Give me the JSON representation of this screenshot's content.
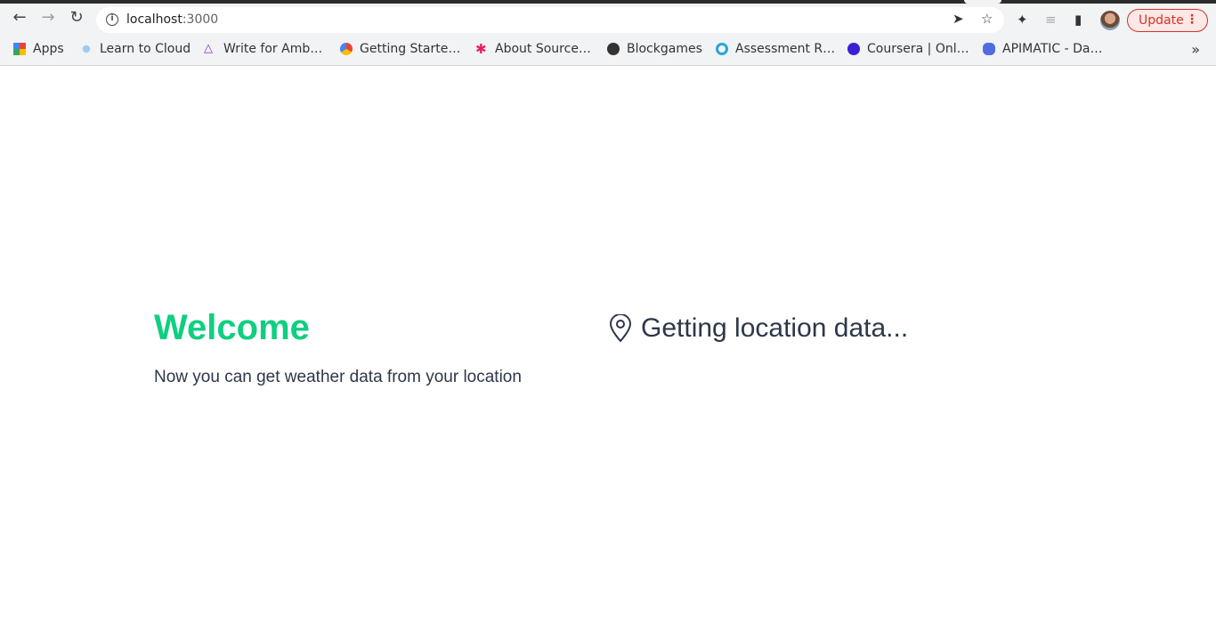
{
  "browser": {
    "url_host": "localhost",
    "url_port": ":3000",
    "update_label": "Update",
    "bookmarks": [
      {
        "label": "Apps",
        "icon": "apps-grid-icon",
        "color": "#4285f4"
      },
      {
        "label": "Learn to Cloud",
        "icon": "cloud-icon",
        "color": "#9ecbf0"
      },
      {
        "label": "Write for Amb…",
        "icon": "ambassador-icon",
        "color": "#8a2be2"
      },
      {
        "label": "Getting Starte…",
        "icon": "google-cloud-icon",
        "color": "#fbbc05"
      },
      {
        "label": "About Source…",
        "icon": "sourcegraph-icon",
        "color": "#e91e63"
      },
      {
        "label": "Blockgames",
        "icon": "globe-icon",
        "color": "#333333"
      },
      {
        "label": "Assessment R…",
        "icon": "ring-icon",
        "color": "#2aa5d9"
      },
      {
        "label": "Coursera | Onl…",
        "icon": "coursera-icon",
        "color": "#3b1fd6"
      },
      {
        "label": "APIMATIC - Da…",
        "icon": "apimatic-icon",
        "color": "#4f6ce0"
      }
    ],
    "more_label": "»"
  },
  "page": {
    "title": "Welcome",
    "subtitle": "Now you can get weather data from your location",
    "location_status": "Getting location data...",
    "accent_color": "#0fcf80",
    "text_color": "#2d3748"
  }
}
